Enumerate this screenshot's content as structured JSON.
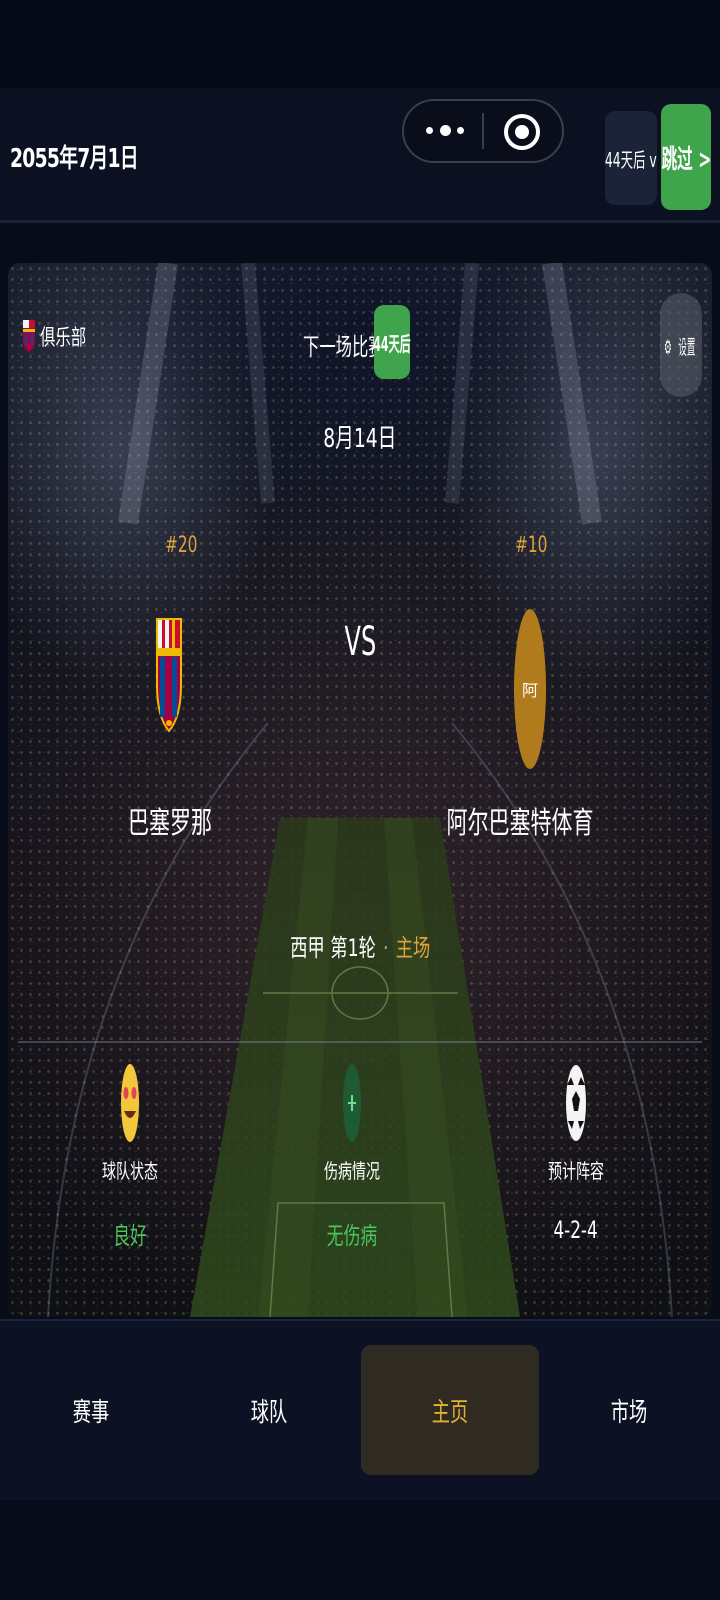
{
  "header": {
    "date": "2055年7月1日",
    "days_button": "44天后 v",
    "skip_button": "跳过 >"
  },
  "card": {
    "club_label": "俱乐部",
    "settings_label": "设置",
    "next_match_label": "下一场比赛",
    "days_badge": "44天后",
    "match_date": "8月14日",
    "vs": "VS",
    "home": {
      "rank": "#20",
      "name": "巴塞罗那"
    },
    "away": {
      "rank": "#10",
      "name": "阿尔巴塞特体育",
      "logo_char": "阿"
    },
    "competition": "西甲 第1轮",
    "separator": "·",
    "venue": "主场",
    "stats": [
      {
        "icon": "smile-icon",
        "label": "球队状态",
        "value": "良好",
        "color": "#4cc55a"
      },
      {
        "icon": "medical-icon",
        "label": "伤病情况",
        "value": "无伤病",
        "color": "#4cc55a"
      },
      {
        "icon": "soccer-ball-icon",
        "label": "预计阵容",
        "value": "4-2-4",
        "color": "#ffffff"
      }
    ]
  },
  "nav": {
    "items": [
      "赛事",
      "球队",
      "主页",
      "市场"
    ],
    "active": "主页"
  },
  "colors": {
    "accent_green": "#3fa44b",
    "accent_gold": "#e0a33a",
    "away_logo": "#b07b1c"
  }
}
